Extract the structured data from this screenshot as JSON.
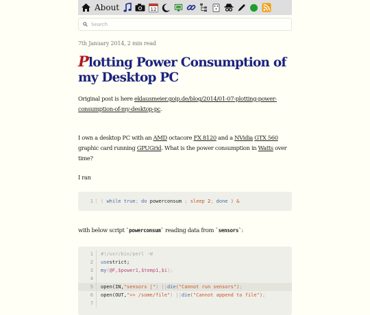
{
  "nav": {
    "about_label": "About",
    "icons": [
      "home-icon",
      "music-icon",
      "camera-icon",
      "calendar-icon",
      "moon-icon",
      "monitor-icon",
      "link-icon",
      "tree-icon",
      "game-icon",
      "spy-icon",
      "pen-icon",
      "green-dot-icon",
      "rss-icon"
    ],
    "calendar_day": "12"
  },
  "search": {
    "placeholder": "Search"
  },
  "post": {
    "meta": "7th January 2014, 2 min read",
    "title_first": "P",
    "title_rest": "lotting Power Consumption of my Desktop PC",
    "p1_text": "Original post is here ",
    "p1_link": "eklausmeier.goip.de/blog/2014/01-07-plotting-power-consumption-of-my-desktop-pc",
    "p1_end": ".",
    "p2": {
      "t1": "I own a desktop PC with an ",
      "l1": "AMD",
      "t2": " octacore ",
      "l2": "FX 8120",
      "t3": " and a ",
      "l3": "NVidia",
      "t4": " ",
      "l4": "GTX 560",
      "t5": " graphic card running ",
      "l5": "GPUGrid",
      "t6": ". What is the power consumption in ",
      "l6": "Watts",
      "t7": " over time?"
    },
    "p3": "I ran",
    "p4": {
      "t1": "with below script ",
      "c1": "`powerconsum`",
      "t2": " reading data from ",
      "c2": "`sensors`",
      "t3": ":"
    }
  },
  "code1": {
    "line_no": "1",
    "parts": [
      "( ",
      "while",
      " ",
      "true",
      "; ",
      "do",
      " powerconsum ",
      "; ",
      "sleep",
      " ",
      "2",
      "; ",
      "done",
      " ) &"
    ]
  },
  "code2": {
    "lines": [
      {
        "n": "1",
        "text": "#!/usr/bin/perl -W"
      },
      {
        "n": "2",
        "a": "use",
        "b": " strict;"
      },
      {
        "n": "3",
        "a": "my",
        "b": " (",
        "v": "@F,$power1,$temp1,$i",
        "c": ");"
      },
      {
        "n": "4"
      },
      {
        "n": "5",
        "o1": "open(IN,",
        "s1": "\"sensors |\"",
        "o2": ") || ",
        "d": "die",
        "s2": "(\"Cannot run sensors\")",
        "o3": ";"
      },
      {
        "n": "6",
        "o1": "open(OUT,",
        "s1": "\">> /some/file\"",
        "o2": ") || ",
        "d": "die",
        "s2": "(\"Cannot append to file\")",
        "o3": ";"
      },
      {
        "n": "7"
      }
    ]
  }
}
